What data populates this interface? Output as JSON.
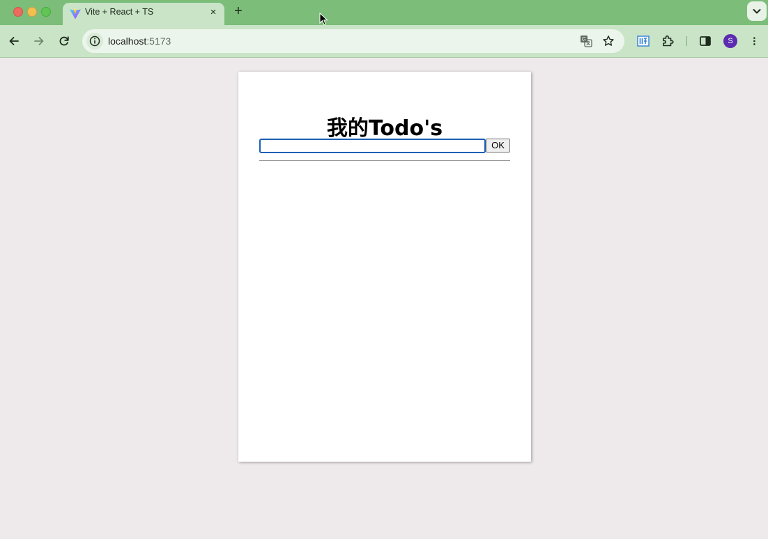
{
  "tab": {
    "title": "Vite + React + TS",
    "close_glyph": "×",
    "favicon": "vite-logo-icon"
  },
  "newtab_glyph": "+",
  "address_bar": {
    "host": "localhost",
    "port": ":5173"
  },
  "profile": {
    "initial": "S",
    "color": "#5b2bb0"
  },
  "page": {
    "title": "我的Todo's",
    "input_value": "",
    "ok_label": "OK"
  },
  "colors": {
    "tabstrip": "#7bbd79",
    "toolbar": "#c9e4c6",
    "page_background": "#eeeaeb",
    "input_focus": "#1a5fb4"
  }
}
